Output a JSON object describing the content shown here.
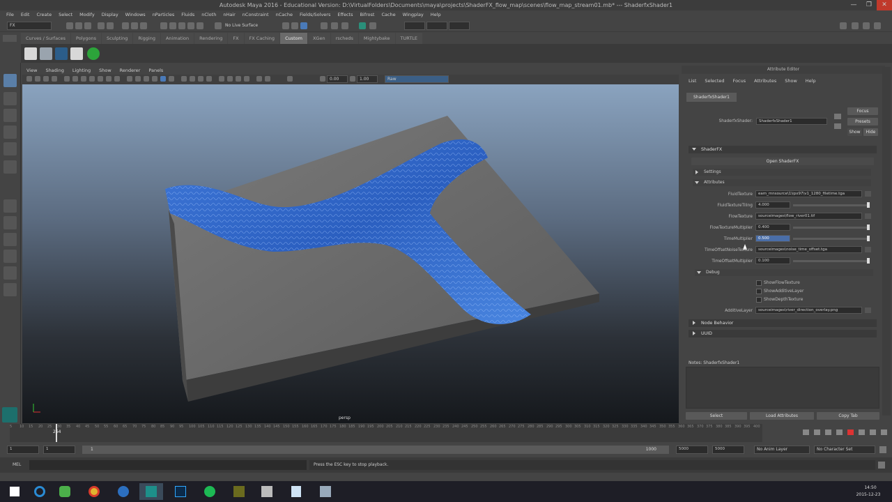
{
  "window": {
    "title": "Autodesk Maya 2016 - Educational Version: D:\\VirtualFolders\\Documents\\maya\\projects\\ShaderFX_flow_map\\scenes\\flow_map_stream01.mb* --- ShaderfxShader1",
    "controls": [
      "—",
      "❐",
      "✕"
    ]
  },
  "menubar": [
    "File",
    "Edit",
    "Create",
    "Select",
    "Modify",
    "Display",
    "Windows",
    "nParticles",
    "Fluids",
    "nCloth",
    "nHair",
    "nConstraint",
    "nCache",
    "Fields/Solvers",
    "Effects",
    "Bifrost",
    "Cache",
    "Wingplay",
    "Help"
  ],
  "statusline": {
    "menuset": "FX",
    "live_surface": "No Live Surface"
  },
  "shelf": {
    "tabs": [
      "Curves / Surfaces",
      "Polygons",
      "Sculpting",
      "Rigging",
      "Animation",
      "Rendering",
      "FX",
      "FX Caching",
      "Custom",
      "XGen",
      "rscheds",
      "Mightybake",
      "TURTLE"
    ],
    "active_tab": "Custom"
  },
  "viewport": {
    "menu": [
      "View",
      "Shading",
      "Lighting",
      "Show",
      "Renderer",
      "Panels"
    ],
    "near_value": "0.00",
    "far_value": "1.00",
    "color_space": "Raw",
    "camera_label": "persp"
  },
  "attribute_editor": {
    "title": "Attribute Editor",
    "menu": [
      "List",
      "Selected",
      "Focus",
      "Attributes",
      "Show",
      "Help"
    ],
    "node_tab": "ShaderfxShader1",
    "node_label": "ShaderfxShader:",
    "node_value": "ShaderfxShader1",
    "buttons": {
      "focus": "Focus",
      "presets": "Presets",
      "show": "Show",
      "hide": "Hide"
    },
    "sections": {
      "shaderfx": "ShaderFX",
      "open_shaderfx": "Open ShaderFX",
      "settings": "Settings",
      "attributes": "Attributes",
      "debug": "Debug",
      "node_behavior": "Node Behavior",
      "uuid": "UUID"
    },
    "attributes": [
      {
        "label": "FluidTexture",
        "value": "eam_mnsource\\1\\ipx97\\v1_1280_filetime.tga",
        "type": "file"
      },
      {
        "label": "FluidTextureTiling",
        "value": "4.000",
        "type": "slider",
        "fraction": 1.0
      },
      {
        "label": "FlowTexture",
        "value": "sourceimages\\flow_river01.tif",
        "type": "file"
      },
      {
        "label": "FlowTextureMultiplier",
        "value": "0.400",
        "type": "slider",
        "fraction": 1.0
      },
      {
        "label": "TimeMultiplier",
        "value": "0.500",
        "type": "slider",
        "fraction": 1.0
      },
      {
        "label": "TimeOffsetNoiseTexture",
        "value": "sourceimages\\noise_time_offset.tga",
        "type": "file"
      },
      {
        "label": "TimeOffsetMultiplier",
        "value": "0.100",
        "type": "slider",
        "fraction": 1.0
      }
    ],
    "debug": {
      "checks": [
        "ShowFlowTexture",
        "ShowAdditiveLayer",
        "ShowDepthTexture"
      ],
      "additive_label": "AdditiveLayer",
      "additive_value": "sourceimages\\river_direction_overlay.png"
    },
    "notes_label": "Notes: ShaderfxShader1",
    "bottom_buttons": [
      "Select",
      "Load Attributes",
      "Copy Tab"
    ]
  },
  "timeline": {
    "ticks": [
      "5",
      "10",
      "15",
      "20",
      "25",
      "30",
      "35",
      "40",
      "45",
      "50",
      "55",
      "60",
      "65",
      "70",
      "75",
      "80",
      "85",
      "90",
      "95",
      "100",
      "105",
      "110",
      "115",
      "120",
      "125",
      "130",
      "135",
      "140",
      "145",
      "150",
      "155",
      "160",
      "165",
      "170",
      "175",
      "180",
      "185",
      "190",
      "195",
      "200",
      "205",
      "210",
      "215",
      "220",
      "225",
      "230",
      "235",
      "240",
      "245",
      "250",
      "255",
      "260",
      "265",
      "270",
      "275",
      "280",
      "285",
      "290",
      "295",
      "300",
      "305",
      "310",
      "315",
      "320",
      "325",
      "330",
      "335",
      "340",
      "345",
      "350",
      "355",
      "360",
      "365",
      "370",
      "375",
      "380",
      "385",
      "390",
      "395",
      "400"
    ],
    "current_frame": "264"
  },
  "range": {
    "start": "1",
    "playback_start": "1",
    "slider_start": "1",
    "slider_end": "1000",
    "playback_end": "5000",
    "end": "5000",
    "anim_layer": "No Anim Layer",
    "character_set": "No Character Set"
  },
  "commandline": {
    "lang": "MEL",
    "help": "Press the ESC key to stop playback."
  },
  "taskbar": {
    "time": "14:50",
    "date": "2015-12-23"
  }
}
